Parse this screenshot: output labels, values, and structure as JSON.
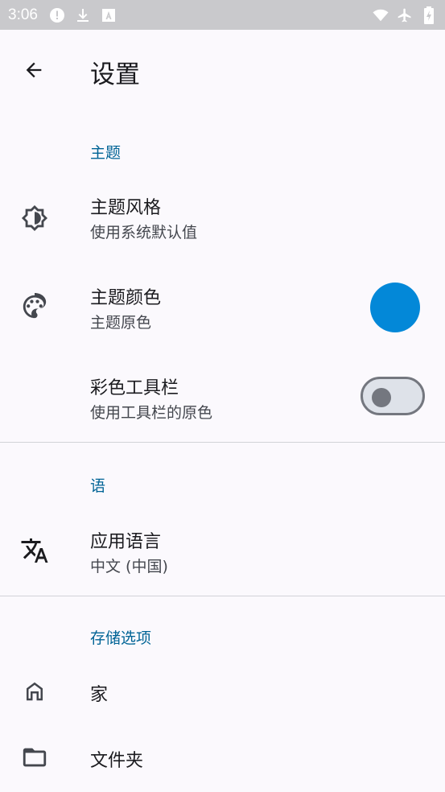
{
  "status_bar": {
    "time": "3:06",
    "left_icons": [
      "alert-icon",
      "download-icon",
      "keyboard-a-icon"
    ],
    "right_icons": [
      "wifi-icon",
      "airplane-icon",
      "battery-charging-icon"
    ]
  },
  "app_bar": {
    "title": "设置",
    "back_icon": "arrow-back-icon"
  },
  "sections": {
    "theme": {
      "header": "主题",
      "theme_style": {
        "title": "主题风格",
        "summary": "使用系统默认值",
        "icon": "brightness-icon"
      },
      "theme_color": {
        "title": "主题颜色",
        "summary": "主题原色",
        "icon": "palette-icon",
        "swatch_color": "#0388d8"
      },
      "colored_toolbar": {
        "title": "彩色工具栏",
        "summary": "使用工具栏的原色",
        "switch_on": false
      }
    },
    "language": {
      "header": "语",
      "app_language": {
        "title": "应用语言",
        "summary": "中文 (中国)",
        "icon": "translate-icon"
      }
    },
    "storage": {
      "header": "存储选项",
      "home": {
        "title": "家",
        "icon": "home-icon"
      },
      "folder": {
        "title": "文件夹",
        "icon": "folder-icon"
      }
    }
  },
  "colors": {
    "accent": "#006496",
    "background": "#fbf9fd",
    "status_bar": "#c9c9cc"
  }
}
